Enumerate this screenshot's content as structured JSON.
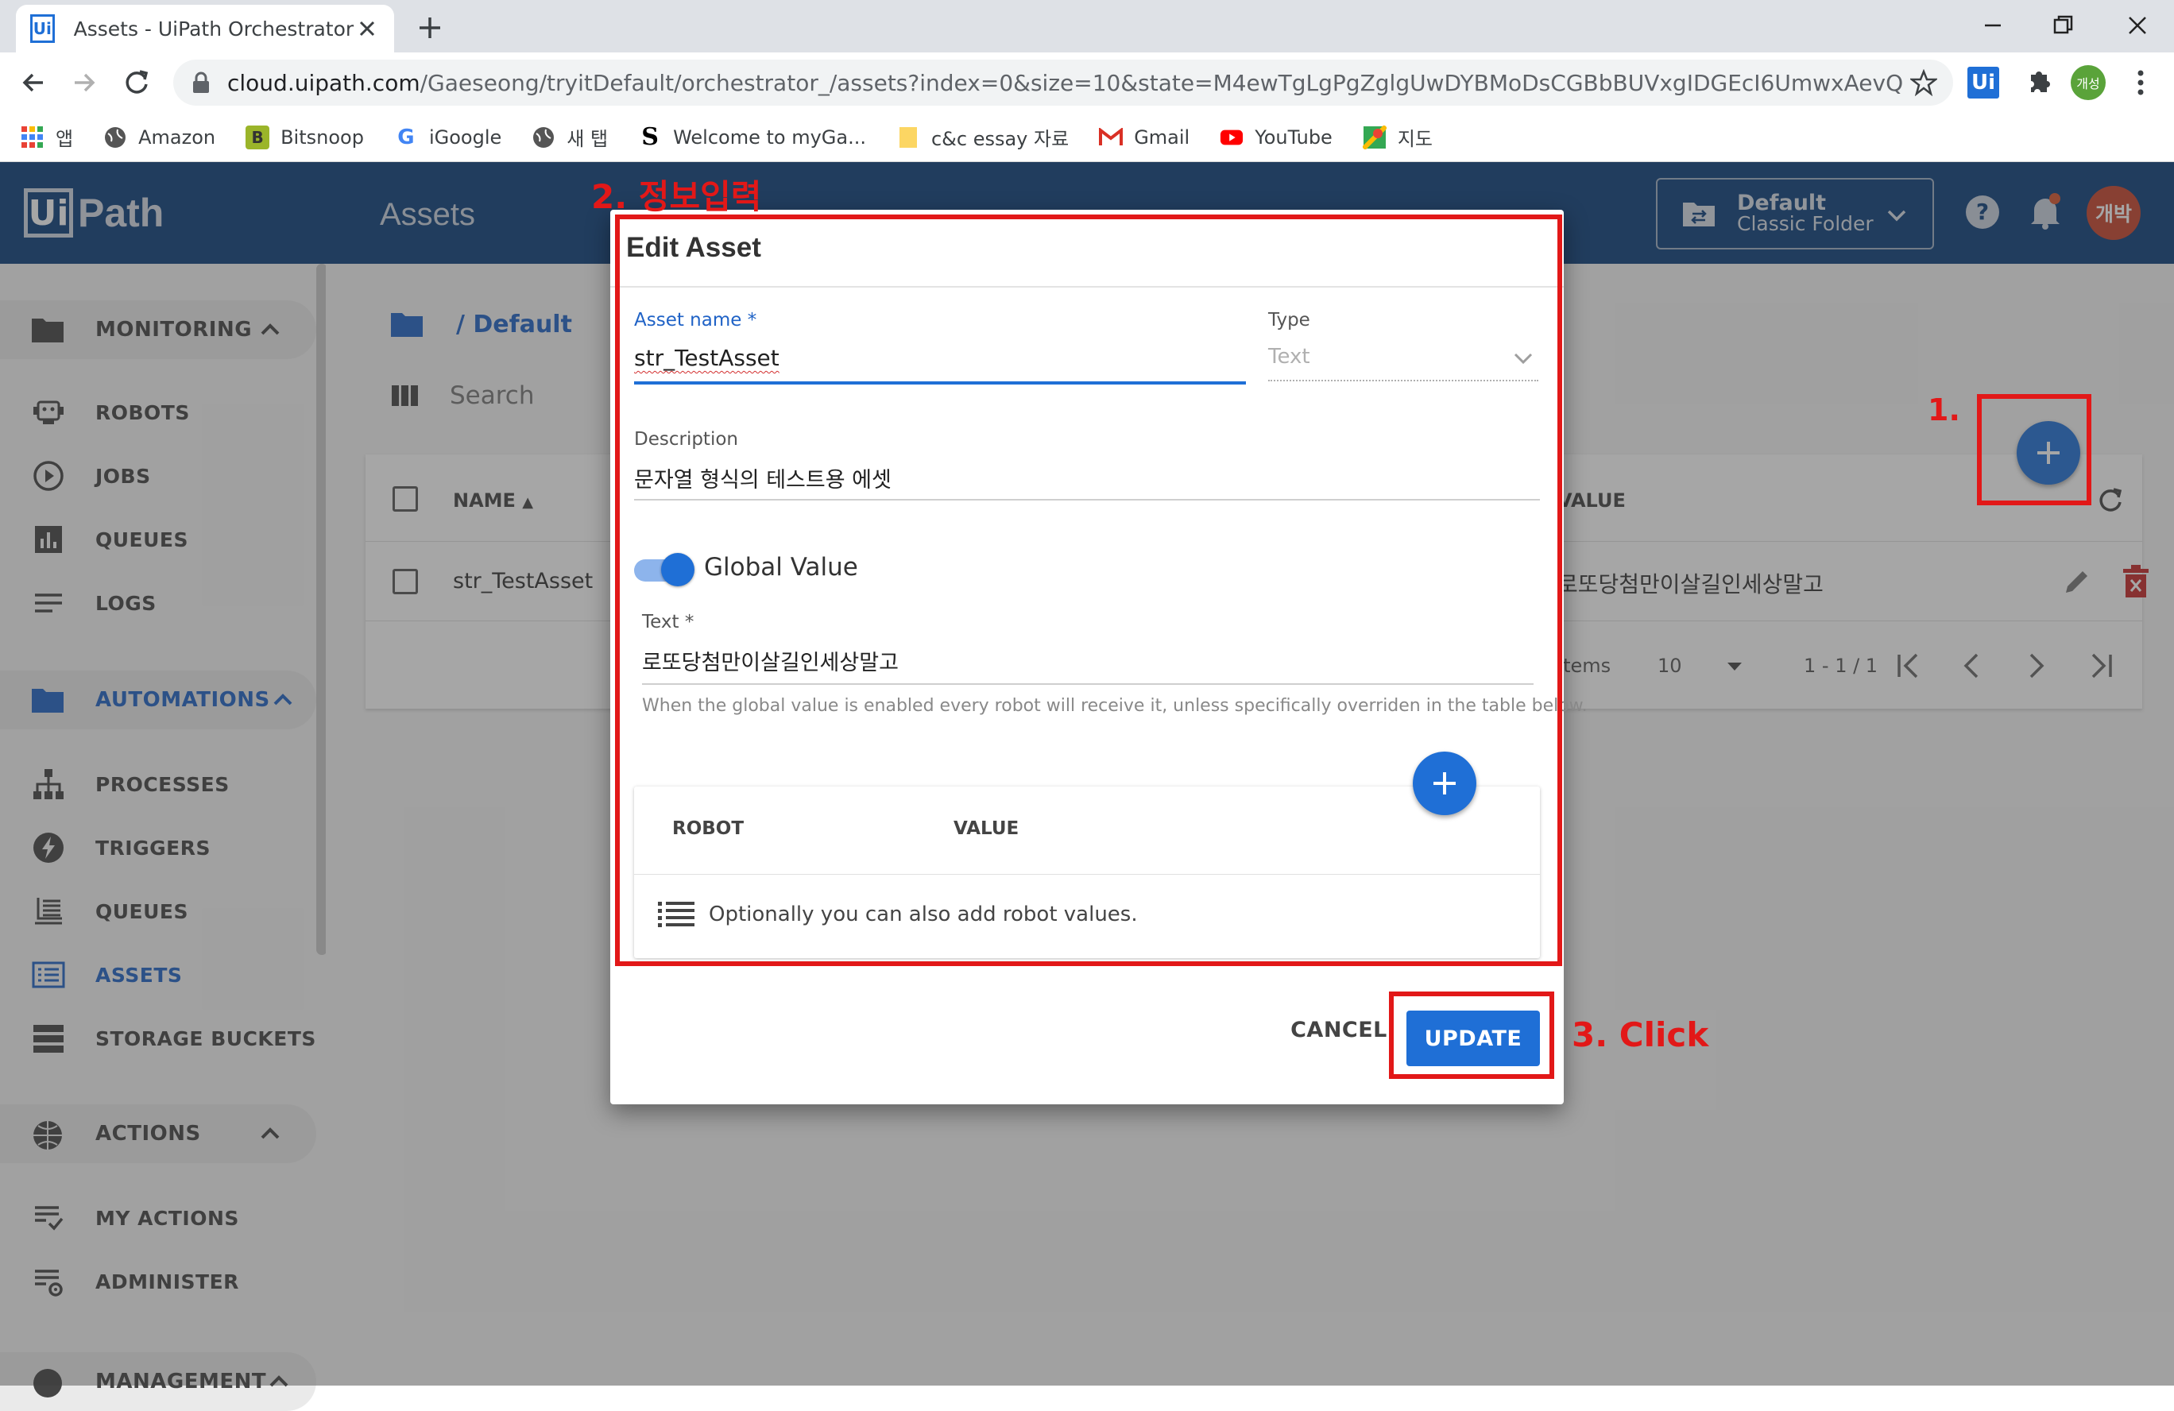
{
  "browser": {
    "tab_title": "Assets - UiPath Orchestrator",
    "tab_favicon": "Ui",
    "url_host": "cloud.uipath.com",
    "url_path": "/Gaeseong/tryitDefault/orchestrator_/assets?index=0&size=10&state=M4ewTgLgPgZglgUwDYBMoDsCGBbBUVxgIDGEcI6UmwxAevQCQAMUDAjF...",
    "profile_badge": "개성",
    "extension_badge": "Ui",
    "bookmarks": [
      {
        "label": "앱",
        "icon": "apps-grid-icon"
      },
      {
        "label": "Amazon",
        "icon": "globe-icon"
      },
      {
        "label": "Bitsnoop",
        "icon": "bitsnoop-icon"
      },
      {
        "label": "iGoogle",
        "icon": "google-icon"
      },
      {
        "label": "새 탭",
        "icon": "globe-icon"
      },
      {
        "label": "Welcome to myGa...",
        "icon": "s-logo-icon"
      },
      {
        "label": "c&c essay 자료",
        "icon": "folder-icon"
      },
      {
        "label": "Gmail",
        "icon": "gmail-icon"
      },
      {
        "label": "YouTube",
        "icon": "youtube-icon"
      },
      {
        "label": "지도",
        "icon": "maps-icon"
      }
    ]
  },
  "header": {
    "logo_box": "Ui",
    "logo_text": "Path",
    "title": "Assets",
    "folder_name": "Default",
    "folder_type": "Classic Folder",
    "avatar": "개박"
  },
  "sidebar": {
    "monitoring": "MONITORING",
    "monitoring_items": [
      "ROBOTS",
      "JOBS",
      "QUEUES",
      "LOGS"
    ],
    "automations": "AUTOMATIONS",
    "automation_items": [
      "PROCESSES",
      "TRIGGERS",
      "QUEUES",
      "ASSETS",
      "STORAGE BUCKETS"
    ],
    "actions": "ACTIONS",
    "action_items": [
      "MY ACTIONS",
      "ADMINISTER"
    ],
    "management": "MANAGEMENT"
  },
  "page": {
    "breadcrumb": "/ Default",
    "search_placeholder": "Search",
    "col_name": "NAME",
    "col_value": "VALUE",
    "row_name": "str_TestAsset",
    "row_value": "로또당첨만이살길인세상말고",
    "items_label": "Items",
    "items_per_page": "10",
    "range": "1 - 1 / 1"
  },
  "dialog": {
    "title": "Edit Asset",
    "asset_name_label": "Asset name *",
    "asset_name_value": "str_TestAsset",
    "type_label": "Type",
    "type_value": "Text",
    "description_label": "Description",
    "description_value": "문자열 형식의 테스트용 에셋",
    "global_value_label": "Global Value",
    "global_value_on": true,
    "text_label": "Text *",
    "text_value": "로또당첨만이살길인세상말고",
    "help_text": "When the global value is enabled every robot will receive it, unless specifically overriden in the table below.",
    "robot_col": "ROBOT",
    "value_col": "VALUE",
    "robot_empty_msg": "Optionally you can also add robot values.",
    "cancel_label": "CANCEL",
    "update_label": "UPDATE"
  },
  "annotations": {
    "step1": "1.",
    "step2": "2. 정보입력",
    "step3": "3. Click",
    "color": "#e21818"
  },
  "colors": {
    "header_bg": "#0a3d7a",
    "primary": "#1f6fd6",
    "active_nav": "#1f62c6",
    "avatar_bg": "#c7432c"
  }
}
